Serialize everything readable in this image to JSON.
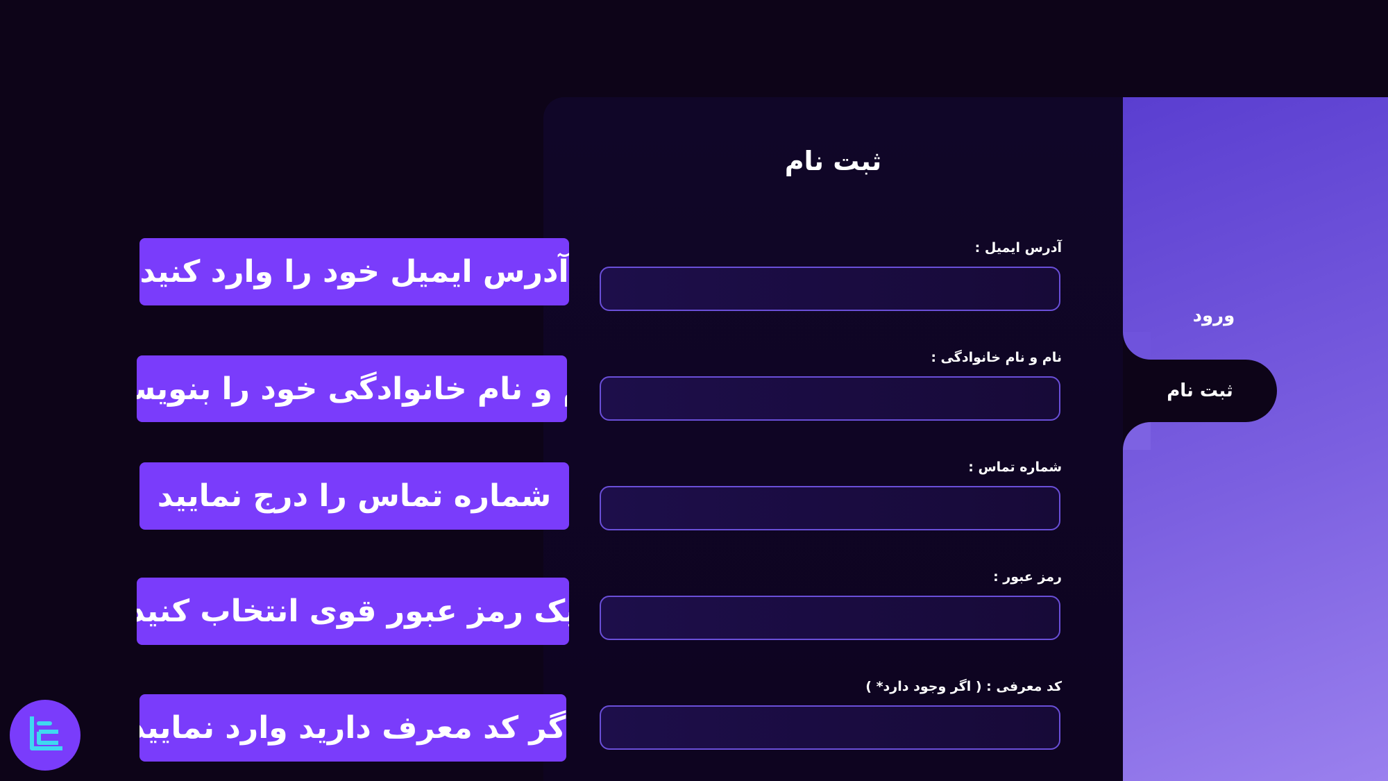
{
  "form": {
    "title": "ثبت نام",
    "fields": [
      {
        "label": "آدرس ایمیل :",
        "value": ""
      },
      {
        "label": "نام و نام خانوادگی :",
        "value": ""
      },
      {
        "label": "شماره تماس :",
        "value": ""
      },
      {
        "label": "رمز عبور :",
        "value": ""
      },
      {
        "label": "کد معرفی : ( اگر وجود دارد* )",
        "value": ""
      }
    ]
  },
  "sidebar": {
    "tabs": [
      {
        "label": "ورود"
      },
      {
        "label": "ثبت نام"
      }
    ]
  },
  "callouts": [
    "آدرس ایمیل خود را وارد کنید",
    "نام و نام خانوادگی خود را بنویسید",
    "شماره تماس را درج نمایید",
    "یک رمز عبور قوی انتخاب کنید",
    "اگر کد معرف دارید وارد نمایید"
  ],
  "colors": {
    "background": "#0d0418",
    "accent": "#7a3cfb",
    "sidebar": "#7b5fe0",
    "input_border": "#6a4fd8",
    "logo_glyph": "#3fd8f0"
  },
  "icons": {
    "logo": "brand-logo-icon"
  }
}
